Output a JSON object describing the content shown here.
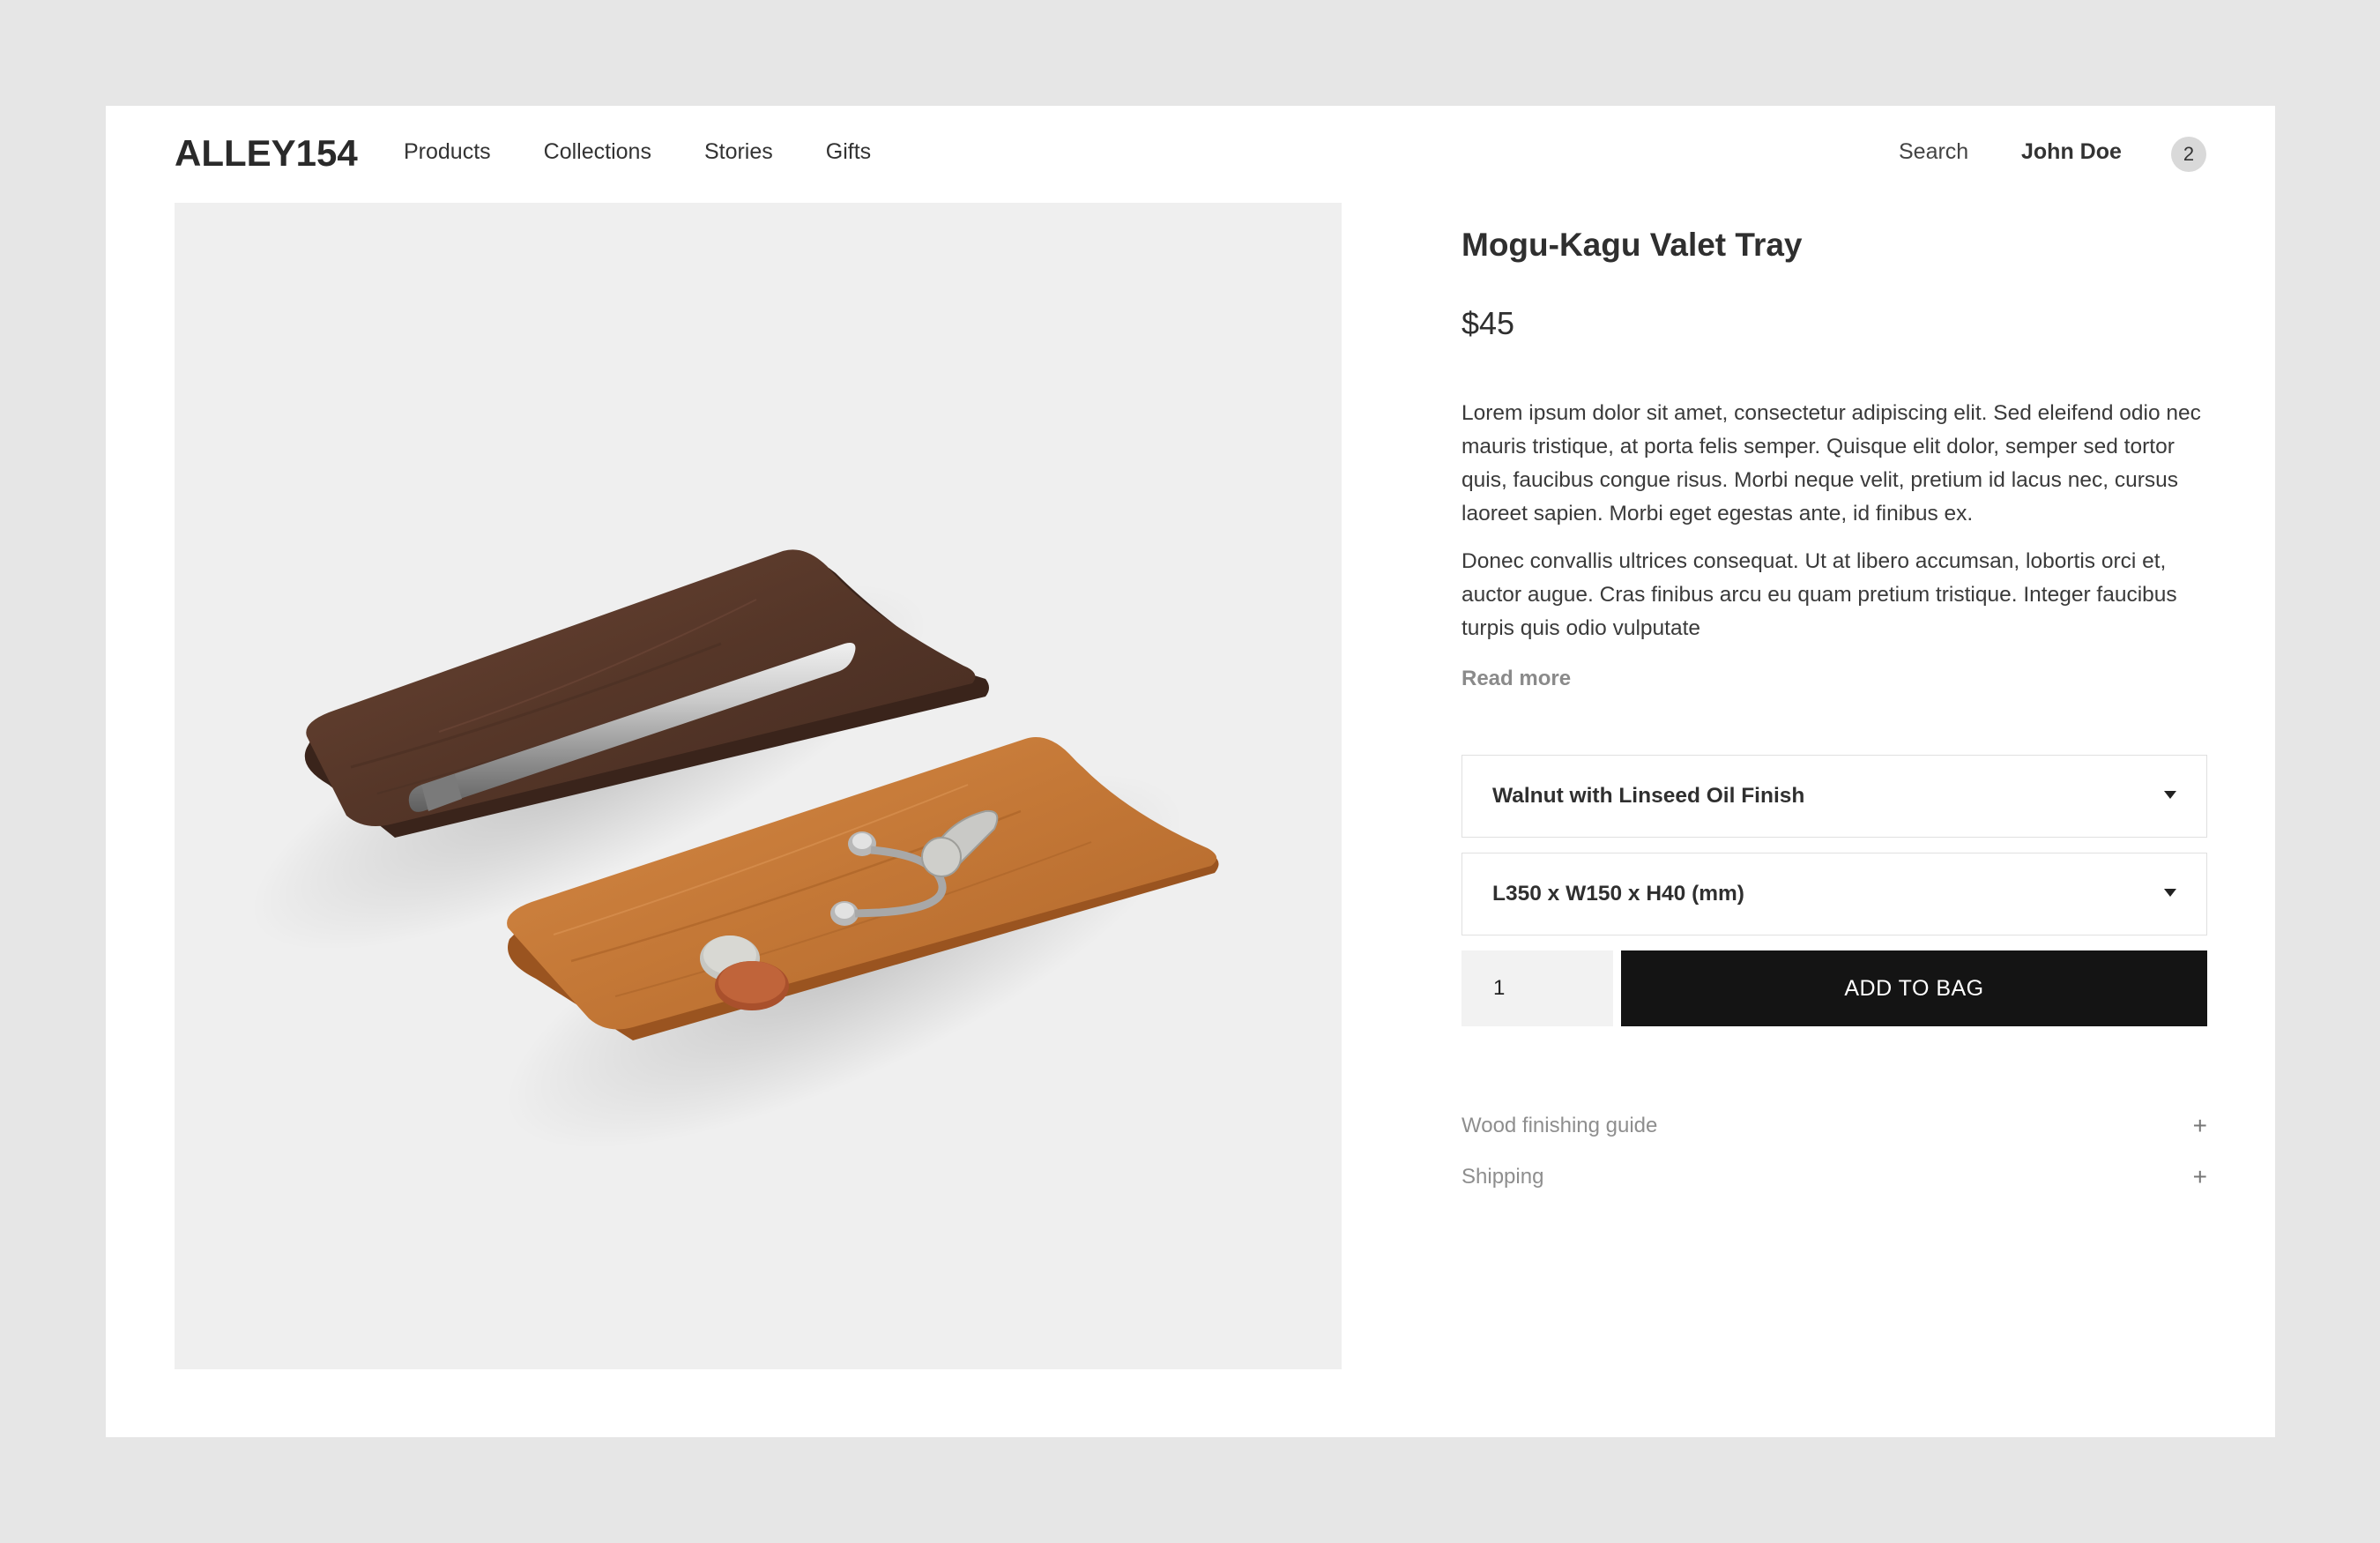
{
  "header": {
    "logo": "ALLEY154",
    "nav": [
      "Products",
      "Collections",
      "Stories",
      "Gifts"
    ],
    "search": "Search",
    "user": "John Doe",
    "cart_count": "2"
  },
  "product": {
    "title": "Mogu-Kagu Valet Tray",
    "price": "$45",
    "description": [
      "Lorem ipsum dolor sit amet, consectetur adipiscing elit. Sed eleifend odio nec mauris tristique, at porta felis semper. Quisque elit dolor, semper sed tortor quis, faucibus congue risus. Morbi neque velit, pretium id lacus nec, cursus laoreet sapien. Morbi eget egestas ante, id finibus ex.",
      "Donec convallis ultrices consequat. Ut at libero accumsan, lobortis orci et, auctor augue. Cras finibus arcu eu quam pretium tristique. Integer faucibus turpis quis odio vulputate"
    ],
    "read_more": "Read more",
    "finish_selected": "Walnut with Linseed Oil Finish",
    "size_selected": "L350 x W150 x H40 (mm)",
    "quantity": "1",
    "add_to_bag": "ADD TO BAG",
    "accordion": [
      "Wood finishing guide",
      "Shipping"
    ],
    "accordion_icon": "+"
  },
  "colors": {
    "page_bg": "#e6e6e6",
    "button_bg": "#141414",
    "walnut": "#5a3a2c",
    "cherry": "#c47a3d"
  }
}
